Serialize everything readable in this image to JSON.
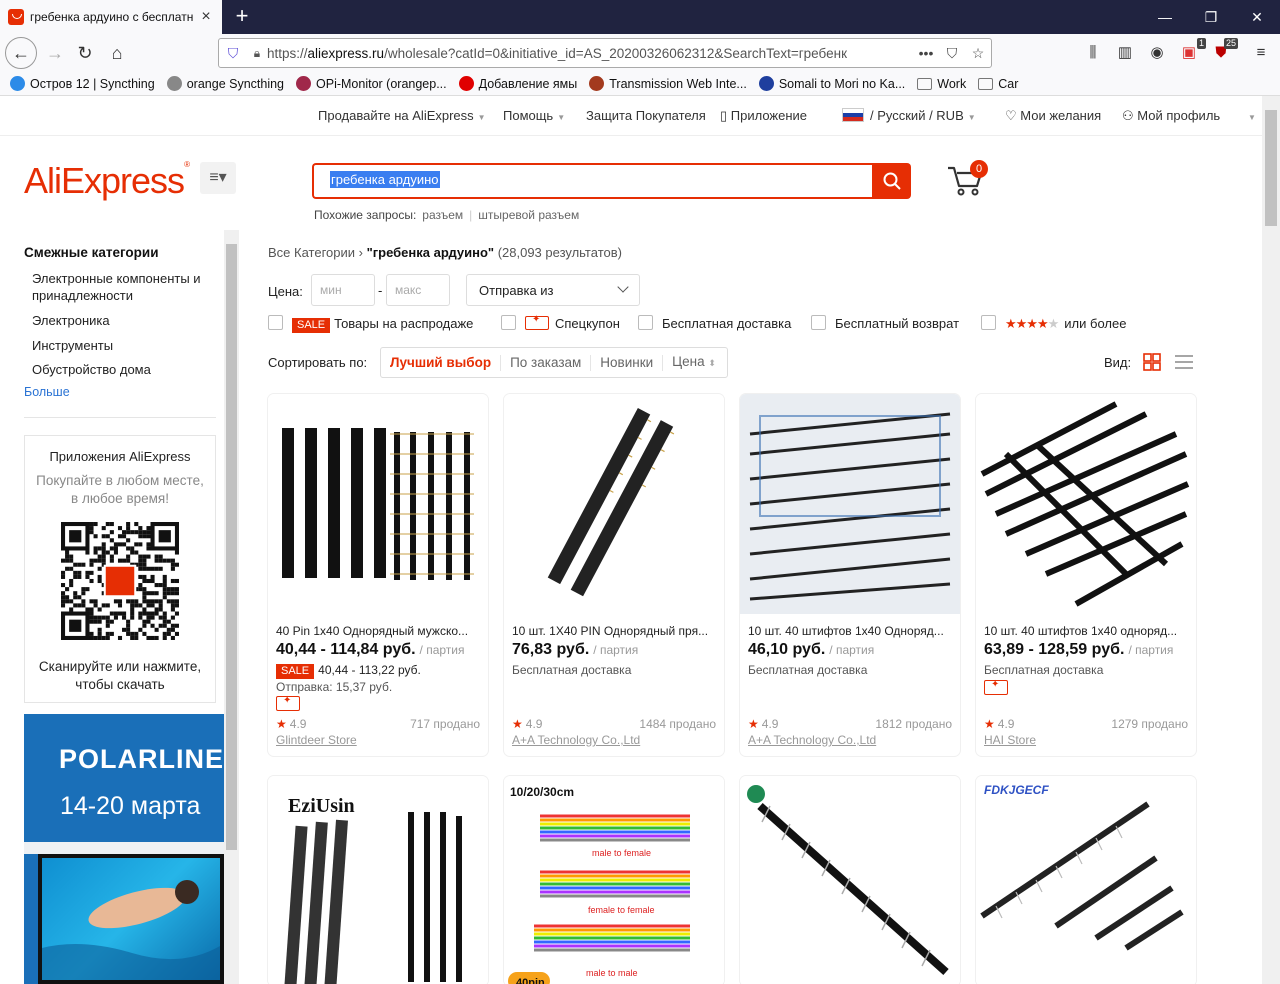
{
  "browser": {
    "tab_title": "гребенка ардуино с бесплатн",
    "url_prefix": "https://",
    "url_domain": "aliexpress.ru",
    "url_rest": "/wholesale?catId=0&initiative_id=AS_20200326062312&SearchText=гребенк",
    "badge_a": "1",
    "badge_b": "25"
  },
  "bookmarks": [
    {
      "label": "Остров 12 | Syncthing",
      "color": "#2c8be8"
    },
    {
      "label": "orange Syncthing",
      "color": "#888888"
    },
    {
      "label": "OPi-Monitor (orangep...",
      "color": "#a0284a"
    },
    {
      "label": "Добавление ямы",
      "color": "#e00000"
    },
    {
      "label": "Transmission Web Inte...",
      "color": "#a33a1e"
    },
    {
      "label": "Somali to Mori no Ka...",
      "color": "#1f3f9e"
    },
    {
      "label": "Work",
      "color": "#777777"
    },
    {
      "label": "Car",
      "color": "#777777"
    }
  ],
  "toplinks": {
    "sell": "Продавайте на AliExpress",
    "help": "Помощь",
    "protection": "Защита Покупателя",
    "app": "Приложение",
    "locale": "/ Русский /  RUB",
    "wishlist": "Мои желания",
    "profile": "Мой профиль"
  },
  "header": {
    "logo": "AliExpress",
    "search_value": "гребенка ардуино",
    "related_label": "Похожие запросы:",
    "related": [
      "разъем",
      "штыревой разъем"
    ],
    "cart_count": "0"
  },
  "sidebar": {
    "heading": "Смежные категории",
    "items": [
      "Электронные компоненты и принадлежности",
      "Электроника",
      "Инструменты",
      "Обустройство дома"
    ],
    "more": "Больше",
    "app_title": "Приложения AliExpress",
    "app_sub": "Покупайте в любом месте, в любое время!",
    "app_scan": "Сканируйте или нажмите, чтобы скачать",
    "promo_brand": "POLARLINE",
    "promo_date": "14-20 марта"
  },
  "main": {
    "breadcrumb_root": "Все Категории",
    "breadcrumb_query": "\"гребенка ардуино\"",
    "breadcrumb_count": "(28,093 результатов)",
    "price_label": "Цена:",
    "price_min": "мин",
    "price_dash": "-",
    "price_max": "макс",
    "ship_from": "Отправка из",
    "filter_sale_tag": "SALE",
    "filter_sale": "Товары на распродаже",
    "filter_coupon": "Спецкупон",
    "filter_freeship": "Бесплатная доставка",
    "filter_freereturn": "Бесплатный возврат",
    "filter_rating": "или более",
    "sort_label": "Сортировать по:",
    "sort_options": [
      "Лучший выбор",
      "По заказам",
      "Новинки",
      "Цена"
    ],
    "view_label": "Вид:"
  },
  "products": [
    {
      "title": "40 Pin 1x40 Однорядный мужско...",
      "price": "40,44 - 114,84 руб.",
      "unit": "/ партия",
      "sale_tag": "SALE",
      "sale_price": "40,44 - 113,22 руб.",
      "shipping": "Отправка: 15,37 руб.",
      "rating": "4.9",
      "sold": "717 продано",
      "store": "Glintdeer Store"
    },
    {
      "title": "10 шт. 1X40 PIN Однорядный пря...",
      "price": "76,83 руб.",
      "unit": "/ партия",
      "shipping": "Бесплатная доставка",
      "rating": "4.9",
      "sold": "1484 продано",
      "store": "A+A Technology Co.,Ltd"
    },
    {
      "title": "10 шт. 40 штифтов 1x40 Одноряд...",
      "price": "46,10 руб.",
      "unit": "/ партия",
      "shipping": "Бесплатная доставка",
      "rating": "4.9",
      "sold": "1812 продано",
      "store": "A+A Technology Co.,Ltd"
    },
    {
      "title": "10 шт. 40 штифтов 1x40 одноряд...",
      "price": "63,89 - 128,59 руб.",
      "unit": "/ партия",
      "shipping": "Бесплатная доставка",
      "rating": "4.9",
      "sold": "1279 продано",
      "store": "HAI Store"
    }
  ],
  "row2": {
    "card1_brand": "EziUsin",
    "card2_caption": "10/20/30cm",
    "card2_mf": "male to female",
    "card2_ff": "female to female",
    "card2_mm": "male to male",
    "card2_pin": "40pin",
    "card4_brand": "FDKJGECF"
  }
}
